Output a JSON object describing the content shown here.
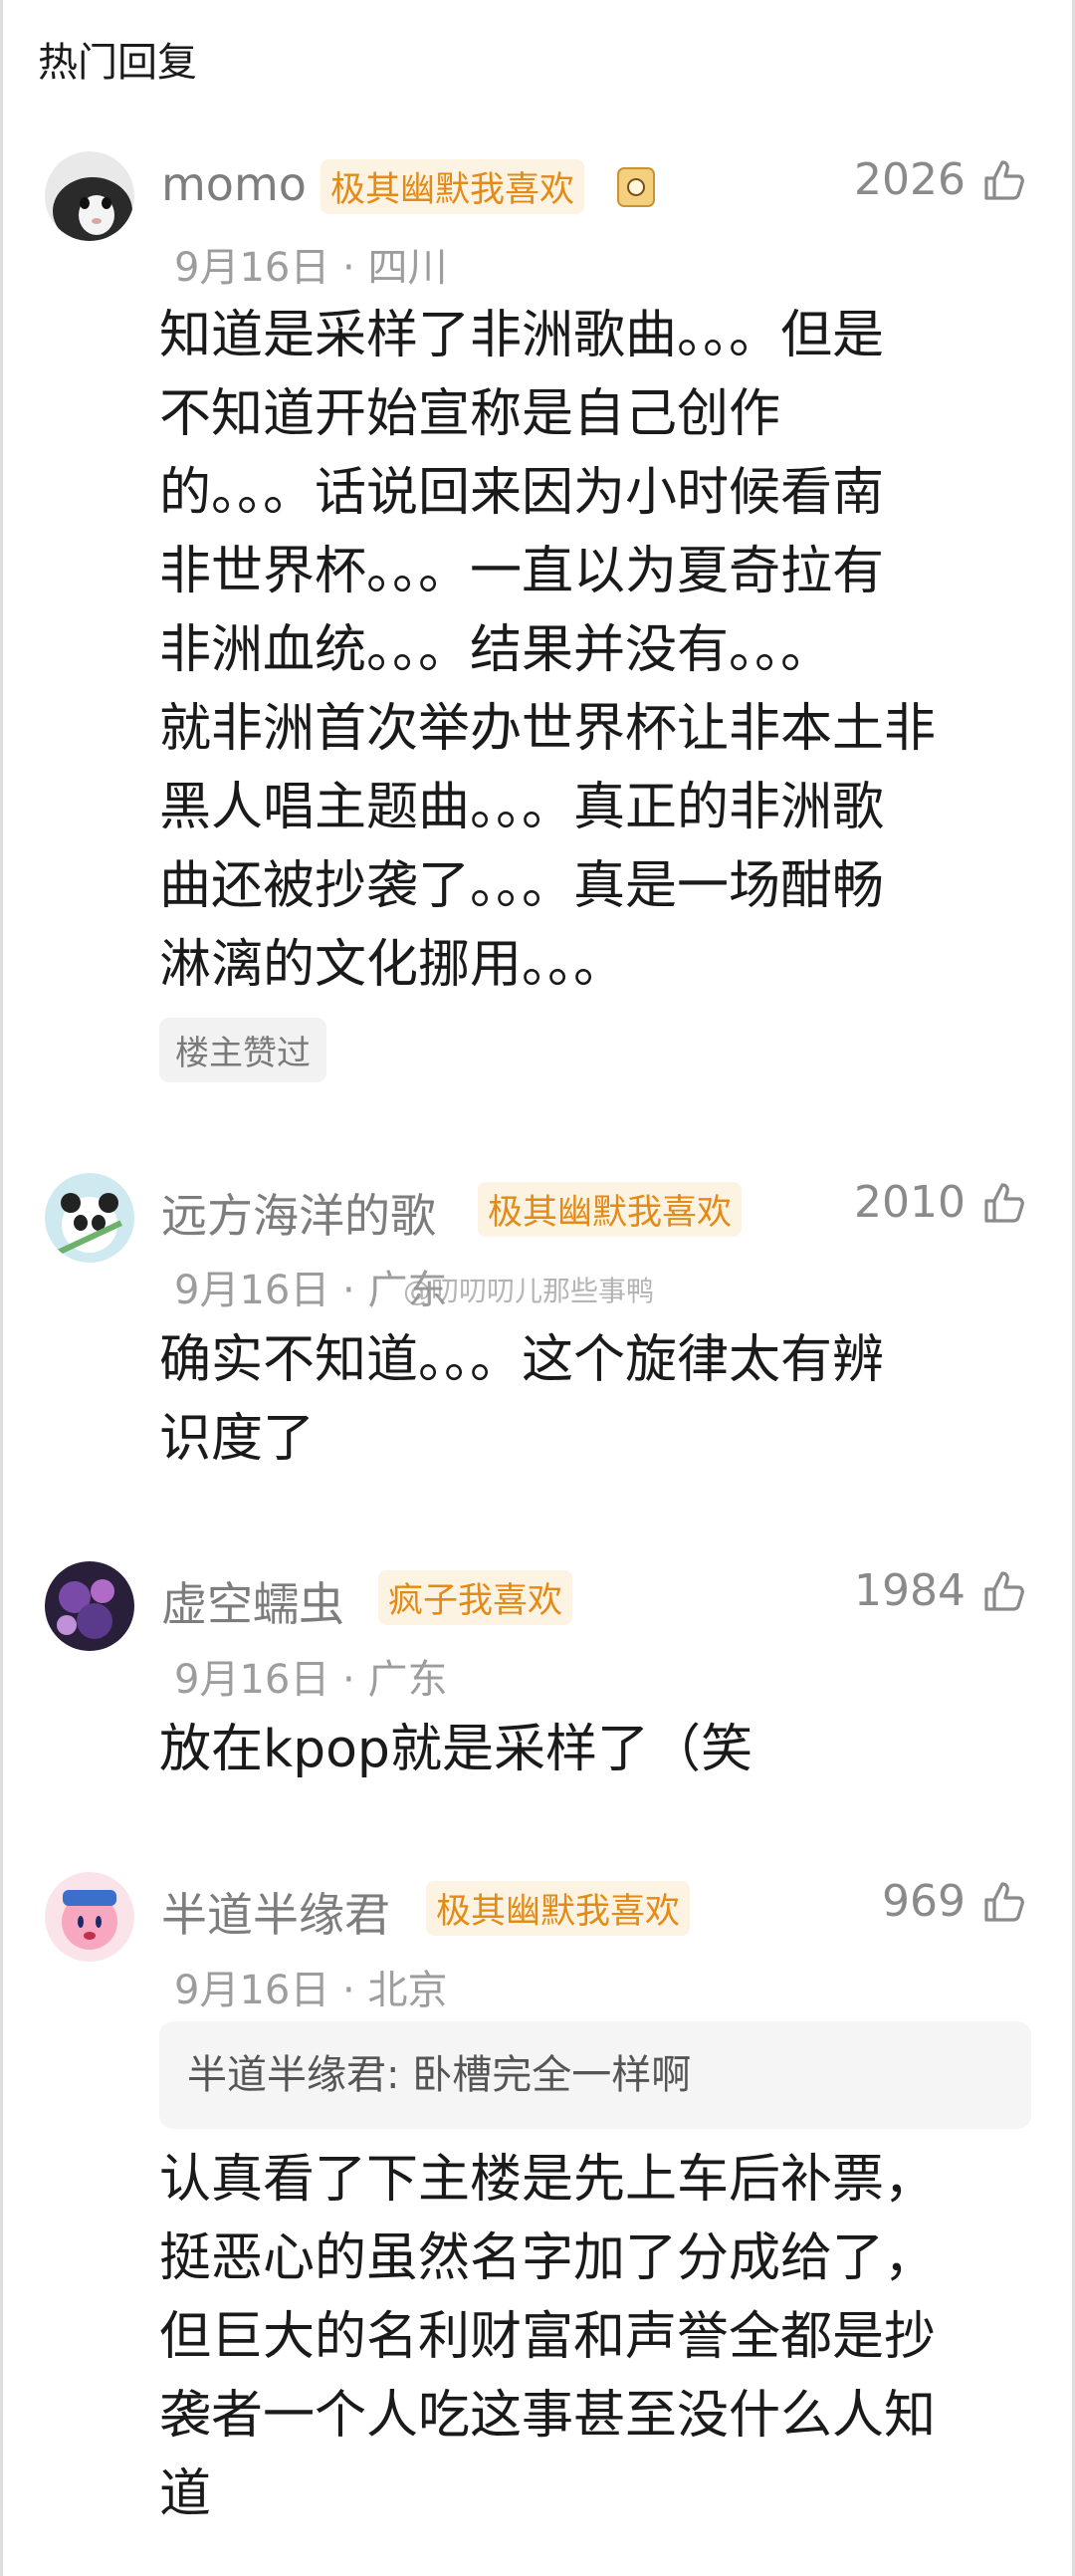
{
  "header": {
    "title": "热门回复"
  },
  "watermark": "@叨叨叨儿那些事鸭",
  "comments": [
    {
      "username": "momo",
      "badge": "极其幽默我喜欢",
      "has_flair_icon": true,
      "likes": "2026",
      "date_location": "9月16日 · 四川",
      "text": "知道是采样了非洲歌曲。。。但是\n不知道开始宣称是自己创作\n的。。。话说回来因为小时候看南\n非世界杯。。。一直以为夏奇拉有\n非洲血统。。。结果并没有。。。\n就非洲首次举办世界杯让非本土非\n黑人唱主题曲。。。真正的非洲歌\n曲还被抄袭了。。。真是一场酣畅\n淋漓的文化挪用。。。",
      "author_liked": "楼主赞过"
    },
    {
      "username": "远方海洋的歌",
      "badge": "极其幽默我喜欢",
      "likes": "2010",
      "date_location": "9月16日 · 广东",
      "text": "确实不知道。。。这个旋律太有辨\n识度了"
    },
    {
      "username": "虚空蠕虫",
      "badge": "疯子我喜欢",
      "likes": "1984",
      "date_location": "9月16日 · 广东",
      "text": "放在kpop就是采样了（笑"
    },
    {
      "username": "半道半缘君",
      "badge": "极其幽默我喜欢",
      "likes": "969",
      "date_location": "9月16日 · 北京",
      "quote": "半道半缘君: 卧槽完全一样啊",
      "text": "认真看了下主楼是先上车后补票，\n挺恶心的虽然名字加了分成给了，\n但巨大的名利财富和声誉全都是抄\n袭者一个人吃这事甚至没什么人知\n道"
    }
  ],
  "icons": {
    "like": "thumbs-up-outline-icon",
    "flair": "emoji-sticker-icon"
  },
  "colors": {
    "badge_text": "#e48a16",
    "badge_bg": "#fdf3e2",
    "username": "#7d7d7d",
    "meta": "#9d9d9d"
  }
}
